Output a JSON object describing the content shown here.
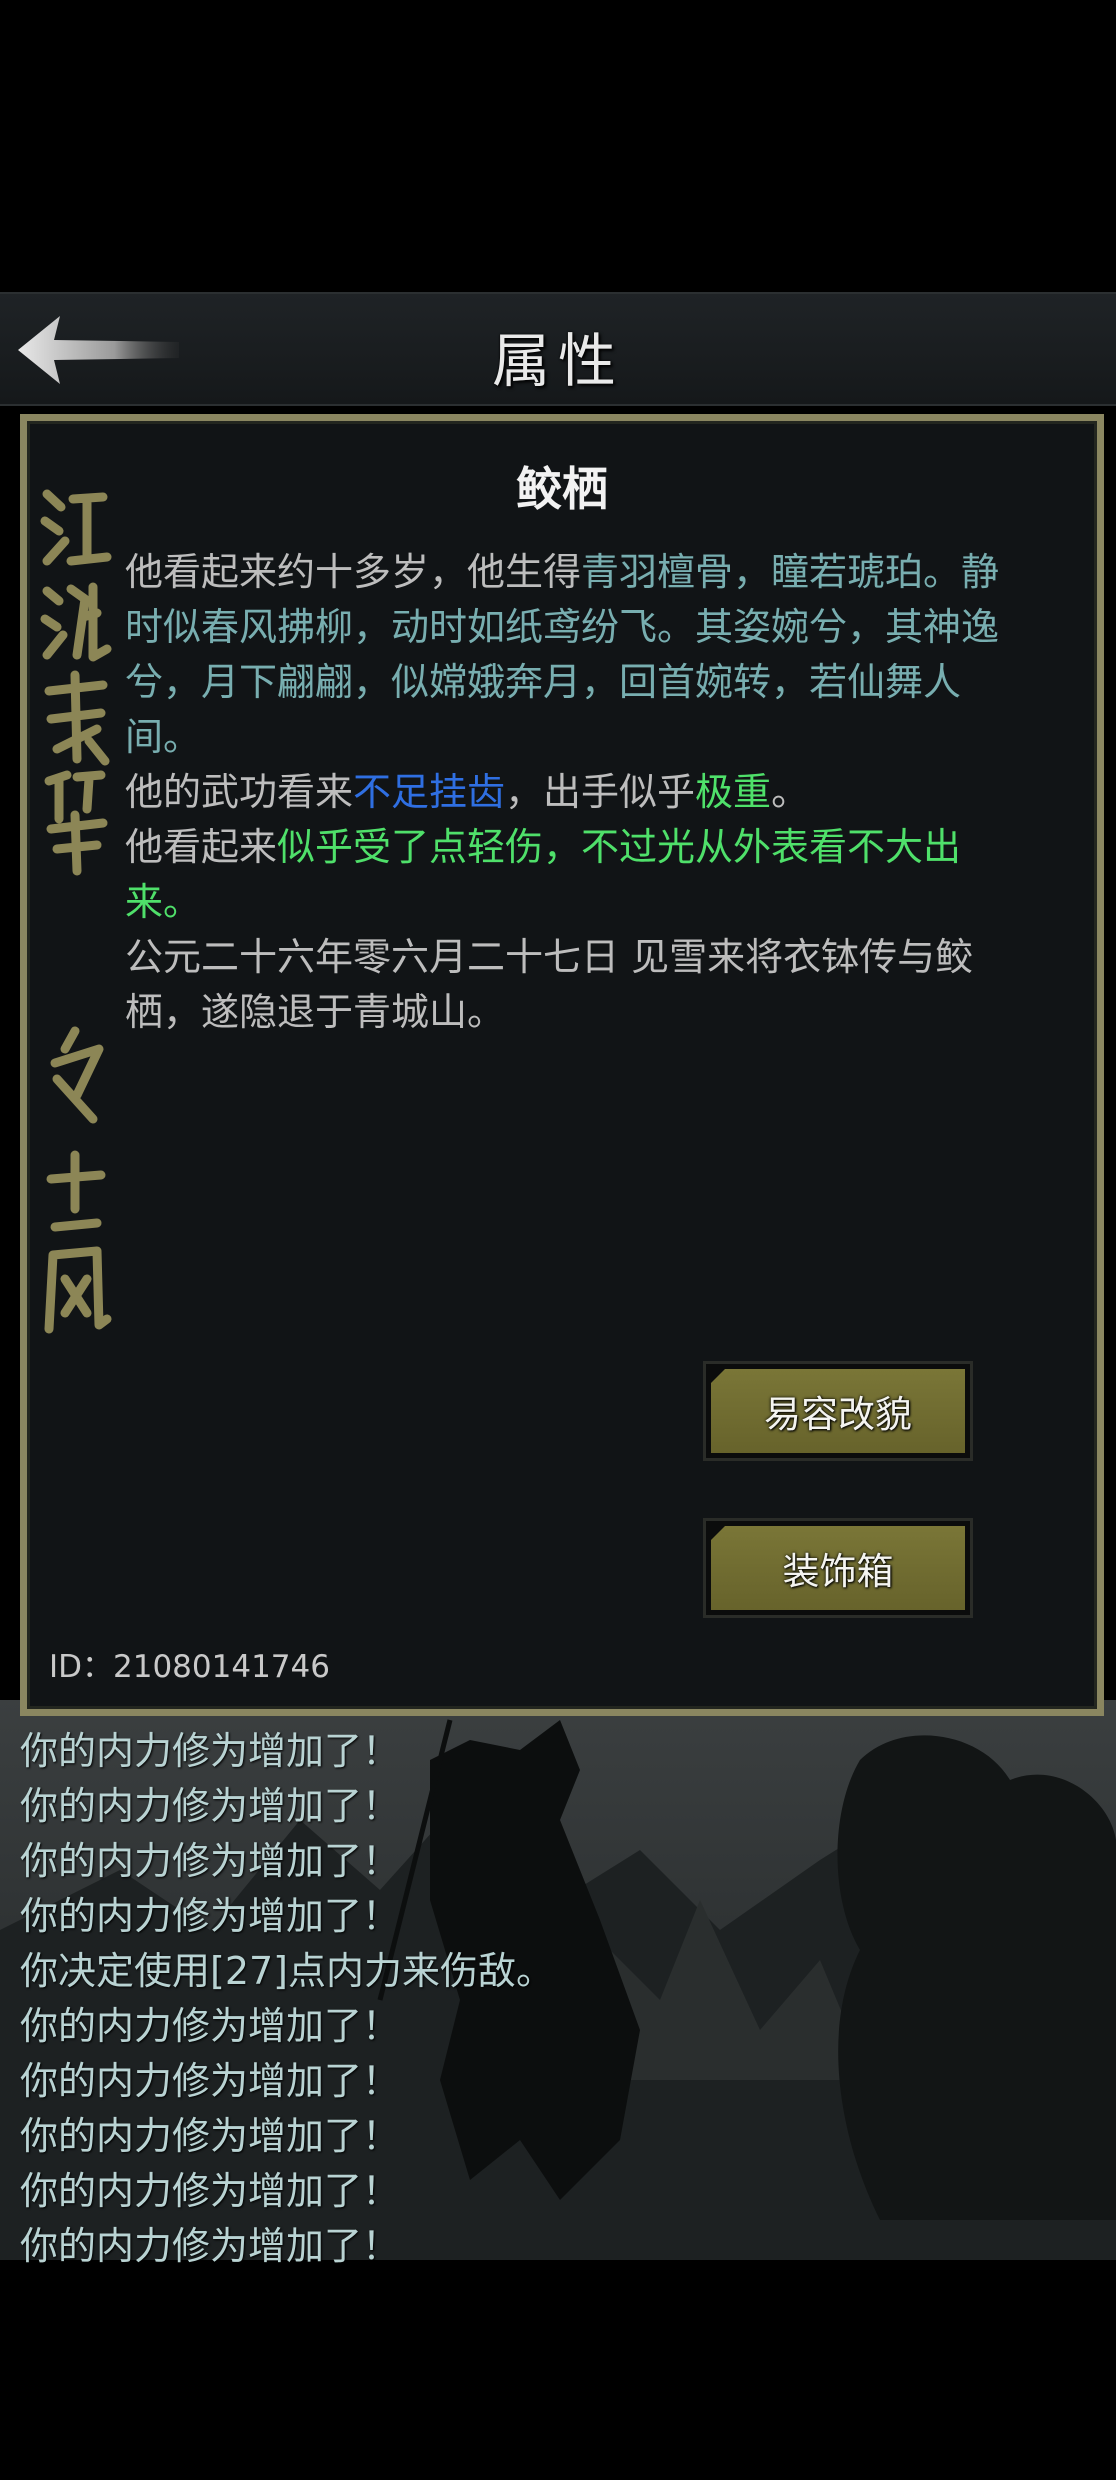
{
  "header": {
    "title": "属性",
    "back_icon": "back-arrow-icon"
  },
  "panel": {
    "calligraphy": "江湖我辈 名士风流",
    "character_name": "鲛栖",
    "description": {
      "p1": {
        "a": "他看起来约十多岁，他生得",
        "b": "青羽檀骨，瞳若琥珀。静时似春风拂柳，动时如纸鸢纷飞。其姿婉兮，其神逸兮，月下翩翩，似嫦娥奔月，回首婉转，若仙舞人间。"
      },
      "p2": {
        "a": "他的武功看来",
        "b": "不足挂齿",
        "c": "，出手似乎",
        "d": "极重",
        "e": "。"
      },
      "p3": {
        "a": "他看起来",
        "b": "似乎受了点轻伤，不过光从外表看不大出来。"
      },
      "p4": "公元二十六年零六月二十七日 见雪来将衣钵传与鲛栖，遂隐退于青城山。"
    },
    "buttons": {
      "disguise": "易容改貌",
      "decoration_box": "装饰箱"
    },
    "id_text": "ID：21080141746"
  },
  "log": [
    "你的内力修为增加了！",
    "你的内力修为增加了！",
    "你的内力修为增加了！",
    "你的内力修为增加了！",
    "你决定使用[27]点内力来伤敌。",
    "你的内力修为增加了！",
    "你的内力修为增加了！",
    "你的内力修为增加了！",
    "你的内力修为增加了！",
    "你的内力修为增加了！"
  ],
  "colors": {
    "panel_border": "#8a8660",
    "teal_text": "#78aeb0",
    "blue_text": "#2f6fe2",
    "green_text": "#4fe06a",
    "button_face": "#6f6b30"
  }
}
